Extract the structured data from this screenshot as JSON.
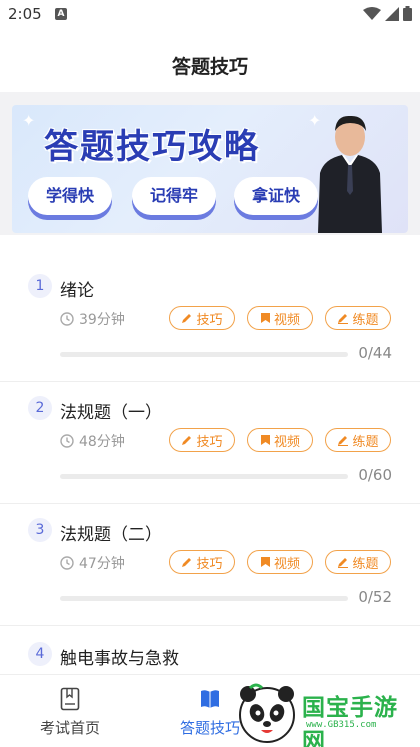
{
  "status_bar": {
    "time": "2:05",
    "notification_badge": "A"
  },
  "header": {
    "title": "答题技巧"
  },
  "banner": {
    "title": "答题技巧攻略",
    "pills": [
      "学得快",
      "记得牢",
      "拿证快"
    ]
  },
  "tags": {
    "tips": "技巧",
    "video": "视频",
    "practice": "练题"
  },
  "chapters": [
    {
      "index": "1",
      "title": "绪论",
      "duration": "39分钟",
      "progress": "0/44",
      "progress_fraction": 0
    },
    {
      "index": "2",
      "title": "法规题（一）",
      "duration": "48分钟",
      "progress": "0/60",
      "progress_fraction": 0
    },
    {
      "index": "3",
      "title": "法规题（二）",
      "duration": "47分钟",
      "progress": "0/52",
      "progress_fraction": 0
    },
    {
      "index": "4",
      "title": "触电事故与急救",
      "duration": "",
      "progress": "",
      "progress_fraction": 0
    }
  ],
  "tabbar": {
    "home_label": "考试首页",
    "tips_label": "答题技巧",
    "active_color": "#2f6de2"
  },
  "watermark": {
    "text": "国宝手游网",
    "url": "www.GB315.com"
  },
  "colors": {
    "accent_blue": "#5a6ad8",
    "tag_orange": "#f08a24"
  }
}
